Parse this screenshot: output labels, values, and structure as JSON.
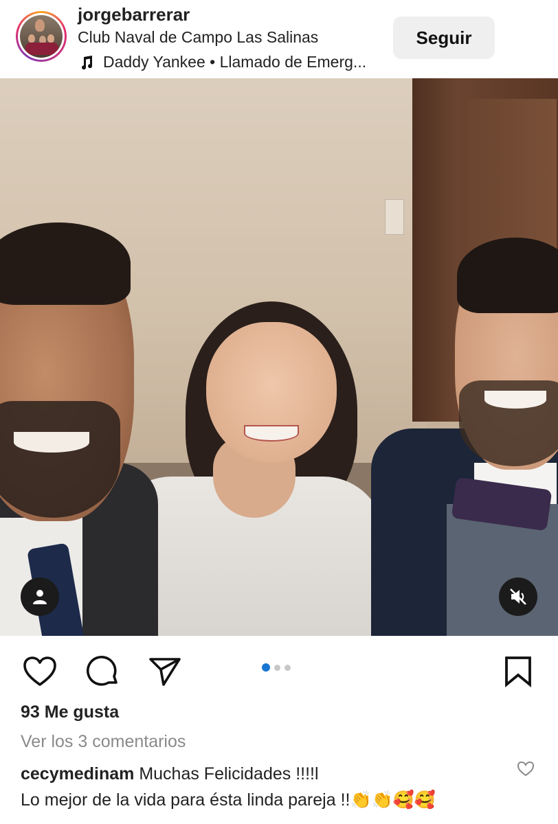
{
  "header": {
    "username": "jorgebarrerar",
    "location": "Club Naval de Campo Las Salinas",
    "music": "Daddy Yankee • Llamado de Emerg...",
    "follow_label": "Seguir"
  },
  "post": {
    "carousel_total": 3,
    "carousel_active": 1,
    "accent_color": "#1976d2"
  },
  "likes": "93 Me gusta",
  "view_comments": "Ver los 3 comentarios",
  "comments": [
    {
      "user": "cecymedinam",
      "text": "Muchas Felicidades !!!!l",
      "text2": "Lo mejor de la vida para ésta linda pareja !!👏👏🥰🥰"
    }
  ],
  "icons": {
    "music": "music-note-icon",
    "tag": "person-tag-icon",
    "mute": "muted-speaker-icon",
    "like": "heart-icon",
    "comment": "comment-bubble-icon",
    "share": "paper-plane-icon",
    "save": "bookmark-icon"
  }
}
